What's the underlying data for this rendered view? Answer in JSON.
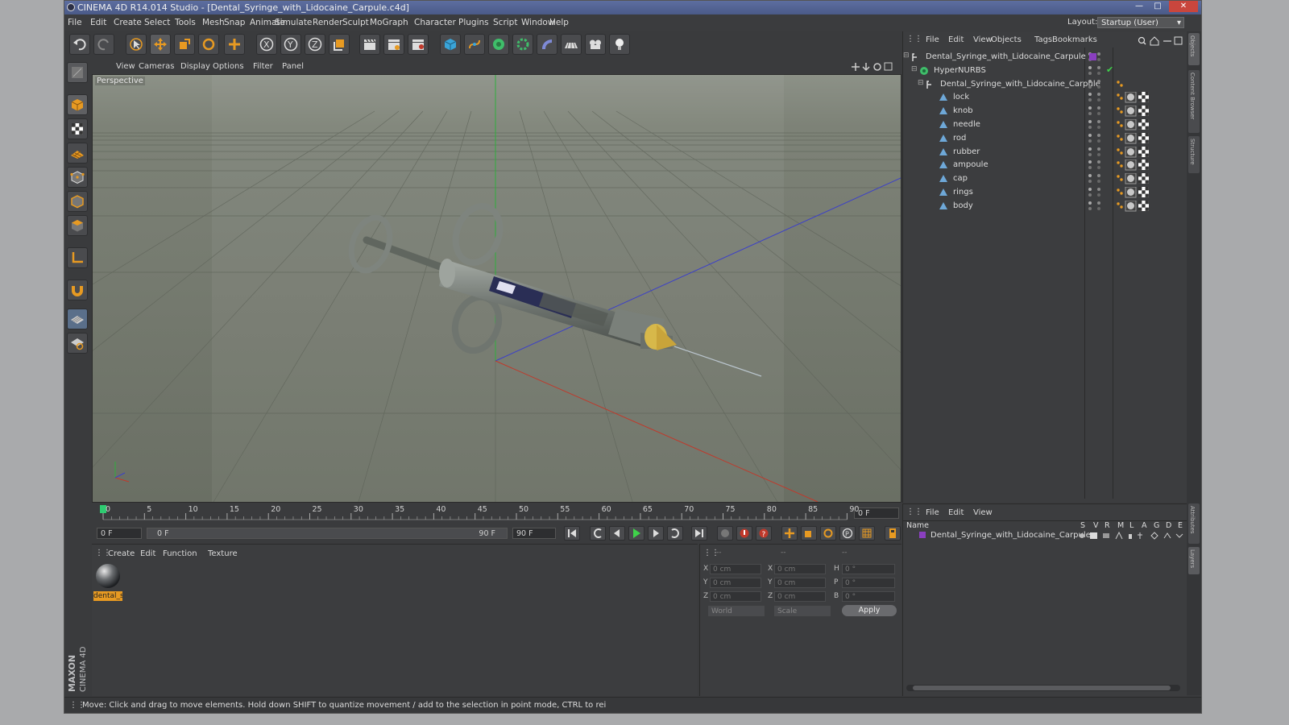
{
  "window": {
    "title": "CINEMA 4D R14.014 Studio - [Dental_Syringe_with_Lidocaine_Carpule.c4d]"
  },
  "menu": [
    "File",
    "Edit",
    "Create",
    "Select",
    "Tools",
    "Mesh",
    "Snap",
    "Animate",
    "Simulate",
    "Render",
    "Sculpt",
    "MoGraph",
    "Character",
    "Plugins",
    "Script",
    "Window",
    "Help"
  ],
  "layout": {
    "label": "Layout:",
    "value": "Startup (User)"
  },
  "viewport": {
    "menu": [
      "View",
      "Cameras",
      "Display",
      "Options",
      "Filter",
      "Panel"
    ],
    "label": "Perspective"
  },
  "timeline": {
    "ticks": [
      "0",
      "5",
      "10",
      "15",
      "20",
      "25",
      "30",
      "35",
      "40",
      "45",
      "50",
      "55",
      "60",
      "65",
      "70",
      "75",
      "80",
      "85",
      "90"
    ],
    "current_frame": "0 F",
    "start_field": "0 F",
    "range_start": "0 F",
    "range_end": "90 F",
    "end_field": "90 F"
  },
  "material_panel": {
    "menu": [
      "Create",
      "Edit",
      "Function",
      "Texture"
    ],
    "material_name": "dental_s"
  },
  "coordinates": {
    "header": [
      "--",
      "--",
      "--"
    ],
    "rows": [
      {
        "a": "X",
        "av": "0 cm",
        "b": "X",
        "bv": "0 cm",
        "c": "H",
        "cv": "0 °"
      },
      {
        "a": "Y",
        "av": "0 cm",
        "b": "Y",
        "bv": "0 cm",
        "c": "P",
        "cv": "0 °"
      },
      {
        "a": "Z",
        "av": "0 cm",
        "b": "Z",
        "bv": "0 cm",
        "c": "B",
        "cv": "0 °"
      }
    ],
    "space": "World",
    "mode": "Scale",
    "apply": "Apply"
  },
  "object_manager": {
    "menu": [
      "File",
      "Edit",
      "View",
      "Objects",
      "Tags",
      "Bookmarks"
    ],
    "objects": [
      {
        "name": "Dental_Syringe_with_Lidocaine_Carpule",
        "depth": 0,
        "type": "null"
      },
      {
        "name": "HyperNURBS",
        "depth": 1,
        "type": "nurbs"
      },
      {
        "name": "Dental_Syringe_with_Lidocaine_Carpule",
        "depth": 2,
        "type": "null"
      },
      {
        "name": "lock",
        "depth": 3,
        "type": "poly"
      },
      {
        "name": "knob",
        "depth": 3,
        "type": "poly"
      },
      {
        "name": "needle",
        "depth": 3,
        "type": "poly"
      },
      {
        "name": "rod",
        "depth": 3,
        "type": "poly"
      },
      {
        "name": "rubber",
        "depth": 3,
        "type": "poly"
      },
      {
        "name": "ampoule",
        "depth": 3,
        "type": "poly"
      },
      {
        "name": "cap",
        "depth": 3,
        "type": "poly"
      },
      {
        "name": "rings",
        "depth": 3,
        "type": "poly"
      },
      {
        "name": "body",
        "depth": 3,
        "type": "poly"
      }
    ]
  },
  "layer_manager": {
    "menu": [
      "File",
      "Edit",
      "View"
    ],
    "columns": [
      "Name",
      "S",
      "V",
      "R",
      "M",
      "L",
      "A",
      "G",
      "D",
      "E"
    ],
    "layer_name": "Dental_Syringe_with_Lidocaine_Carpule",
    "layer_color": "#8a3fc0"
  },
  "right_tabs": [
    "Objects",
    "Content Browser",
    "Structure",
    "Attributes",
    "Layers"
  ],
  "brand": {
    "line1": "MAXON",
    "line2": "CINEMA 4D"
  },
  "status": "Move: Click and drag to move elements. Hold down SHIFT to quantize movement / add to the selection in point mode, CTRL to rei",
  "colors": {
    "accent_orange": "#e79a22",
    "timeline_green": "#2ecc71",
    "axis_x": "#c0392b",
    "axis_y": "#2eae3c",
    "axis_z": "#3c40c8"
  }
}
